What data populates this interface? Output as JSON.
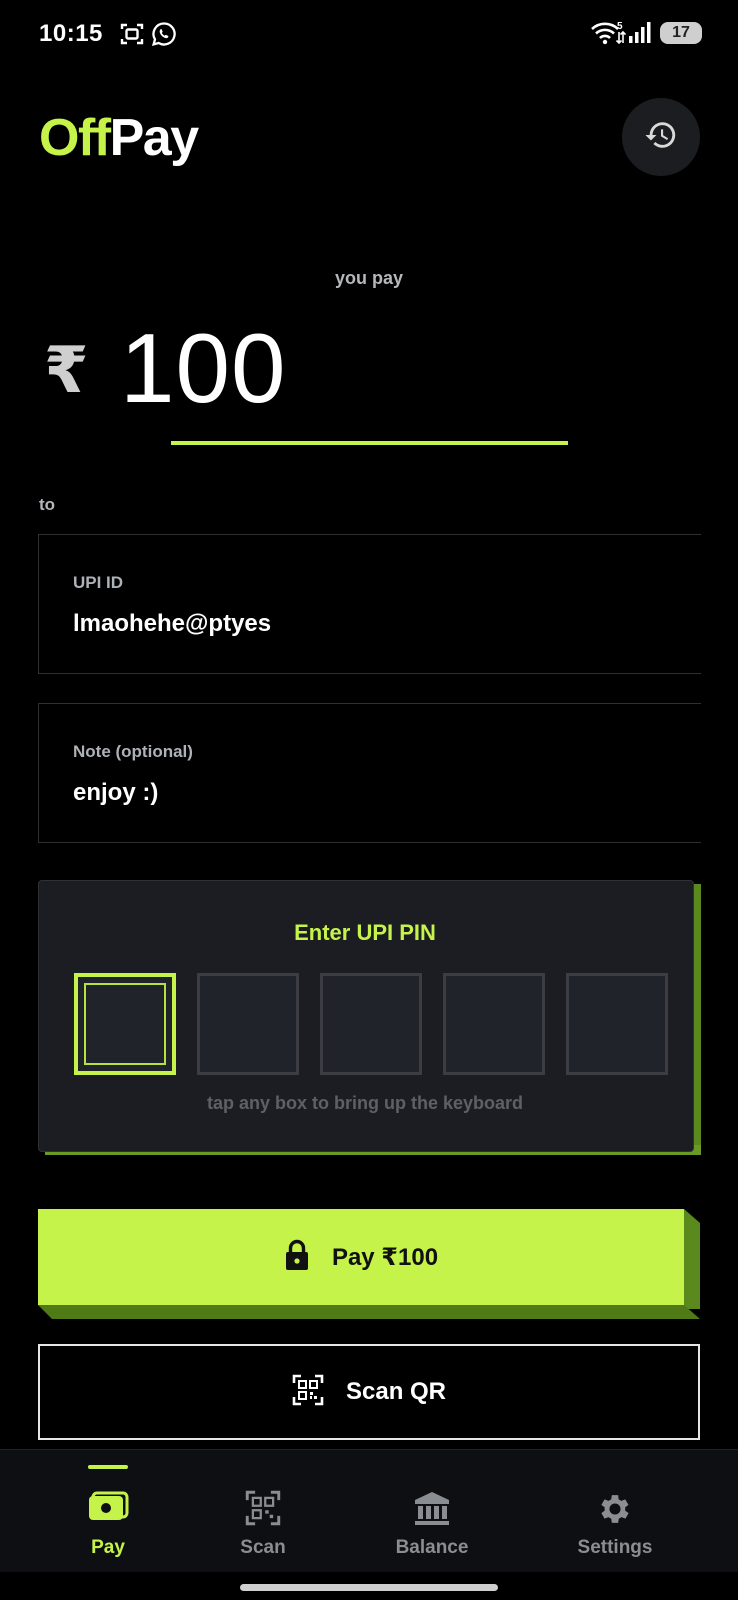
{
  "status_bar": {
    "time": "10:15",
    "network_badge": "5",
    "battery": "17"
  },
  "header": {
    "logo_accent": "Off",
    "logo_rest": "Pay"
  },
  "amount": {
    "label": "you pay",
    "currency": "₹",
    "value": "100"
  },
  "recipient": {
    "to_label": "to",
    "upi_label": "UPI ID",
    "upi_value": "lmaohehe@ptyes",
    "note_label": "Note (optional)",
    "note_value": "enjoy :)"
  },
  "pin": {
    "title": "Enter UPI PIN",
    "hint": "tap any box to bring up the keyboard",
    "length": 5,
    "active_index": 0
  },
  "actions": {
    "pay_label": "Pay ₹100",
    "scan_label": "Scan QR"
  },
  "nav": {
    "items": [
      {
        "label": "Pay",
        "icon": "wallet-icon",
        "active": true
      },
      {
        "label": "Scan",
        "icon": "qr-scan-icon",
        "active": false
      },
      {
        "label": "Balance",
        "icon": "bank-icon",
        "active": false
      },
      {
        "label": "Settings",
        "icon": "gear-icon",
        "active": false
      }
    ]
  },
  "colors": {
    "accent": "#c6f34a",
    "accent_shadow": "#5a8a1e",
    "background": "#000000",
    "card": "#1b1d22",
    "muted_text": "#b5b7bb"
  }
}
